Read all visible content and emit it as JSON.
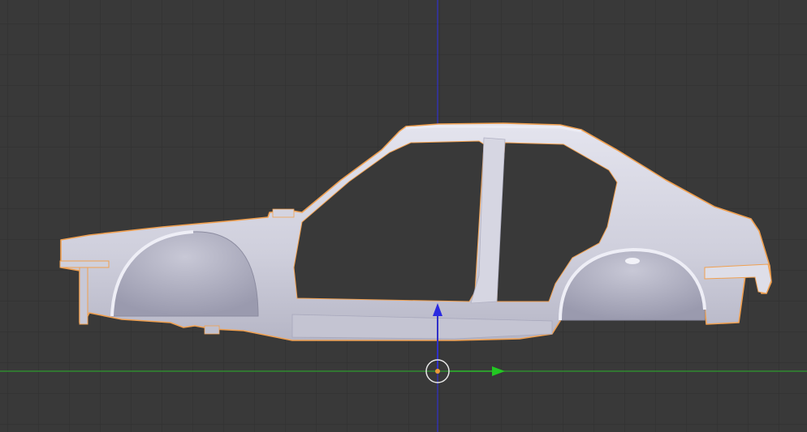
{
  "viewport": {
    "background": "#393939",
    "grid_line_color": "#2f2f2f",
    "x_axis_color": "#2e9a2e",
    "z_axis_color": "#3030c8",
    "selection_outline_color": "#f0a050",
    "mesh_color": "#d8d8e4",
    "mesh_shadow_color": "#a8a8bc"
  },
  "scene": {
    "object_type": "car-body-shell-mesh",
    "view": "side-orthographic"
  },
  "gizmo": {
    "icons": [
      "origin-icon",
      "x-arrow-icon",
      "z-arrow-icon"
    ]
  }
}
